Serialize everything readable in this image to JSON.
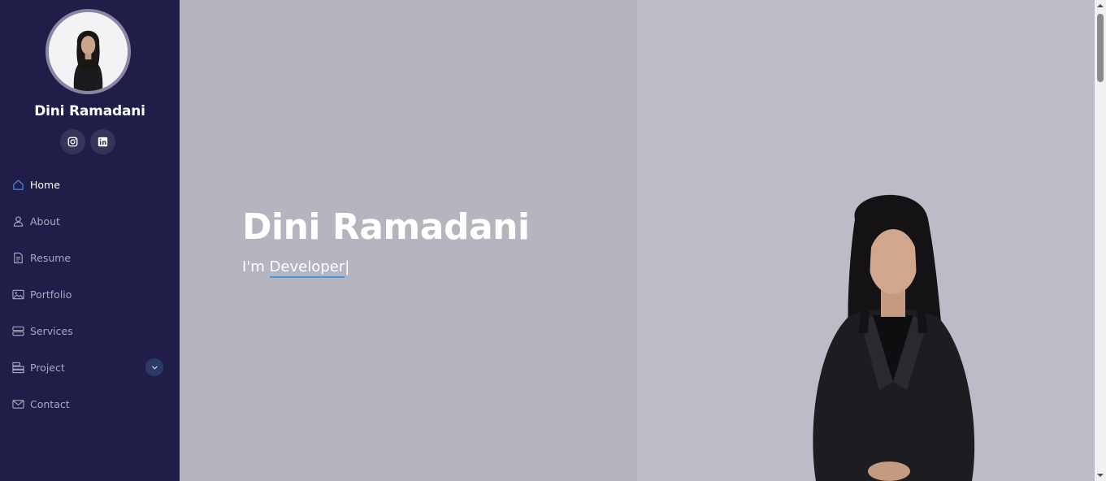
{
  "profile": {
    "name": "Dini Ramadani"
  },
  "socials": [
    {
      "icon": "instagram-icon"
    },
    {
      "icon": "linkedin-icon"
    }
  ],
  "nav": {
    "items": [
      {
        "label": "Home",
        "icon": "home-icon",
        "active": true
      },
      {
        "label": "About",
        "icon": "person-icon"
      },
      {
        "label": "Resume",
        "icon": "file-icon"
      },
      {
        "label": "Portfolio",
        "icon": "images-icon"
      },
      {
        "label": "Services",
        "icon": "server-icon"
      },
      {
        "label": "Project",
        "icon": "stack-icon",
        "has_dropdown": true
      },
      {
        "label": "Contact",
        "icon": "envelope-icon"
      }
    ]
  },
  "hero": {
    "title": "Dini Ramadani",
    "prefix": "I'm",
    "typed": "Developer",
    "caret": "|"
  },
  "colors": {
    "sidebar_bg": "#201d48",
    "accent": "#3d9cf0",
    "hero_bg": "#b6b4bf"
  }
}
